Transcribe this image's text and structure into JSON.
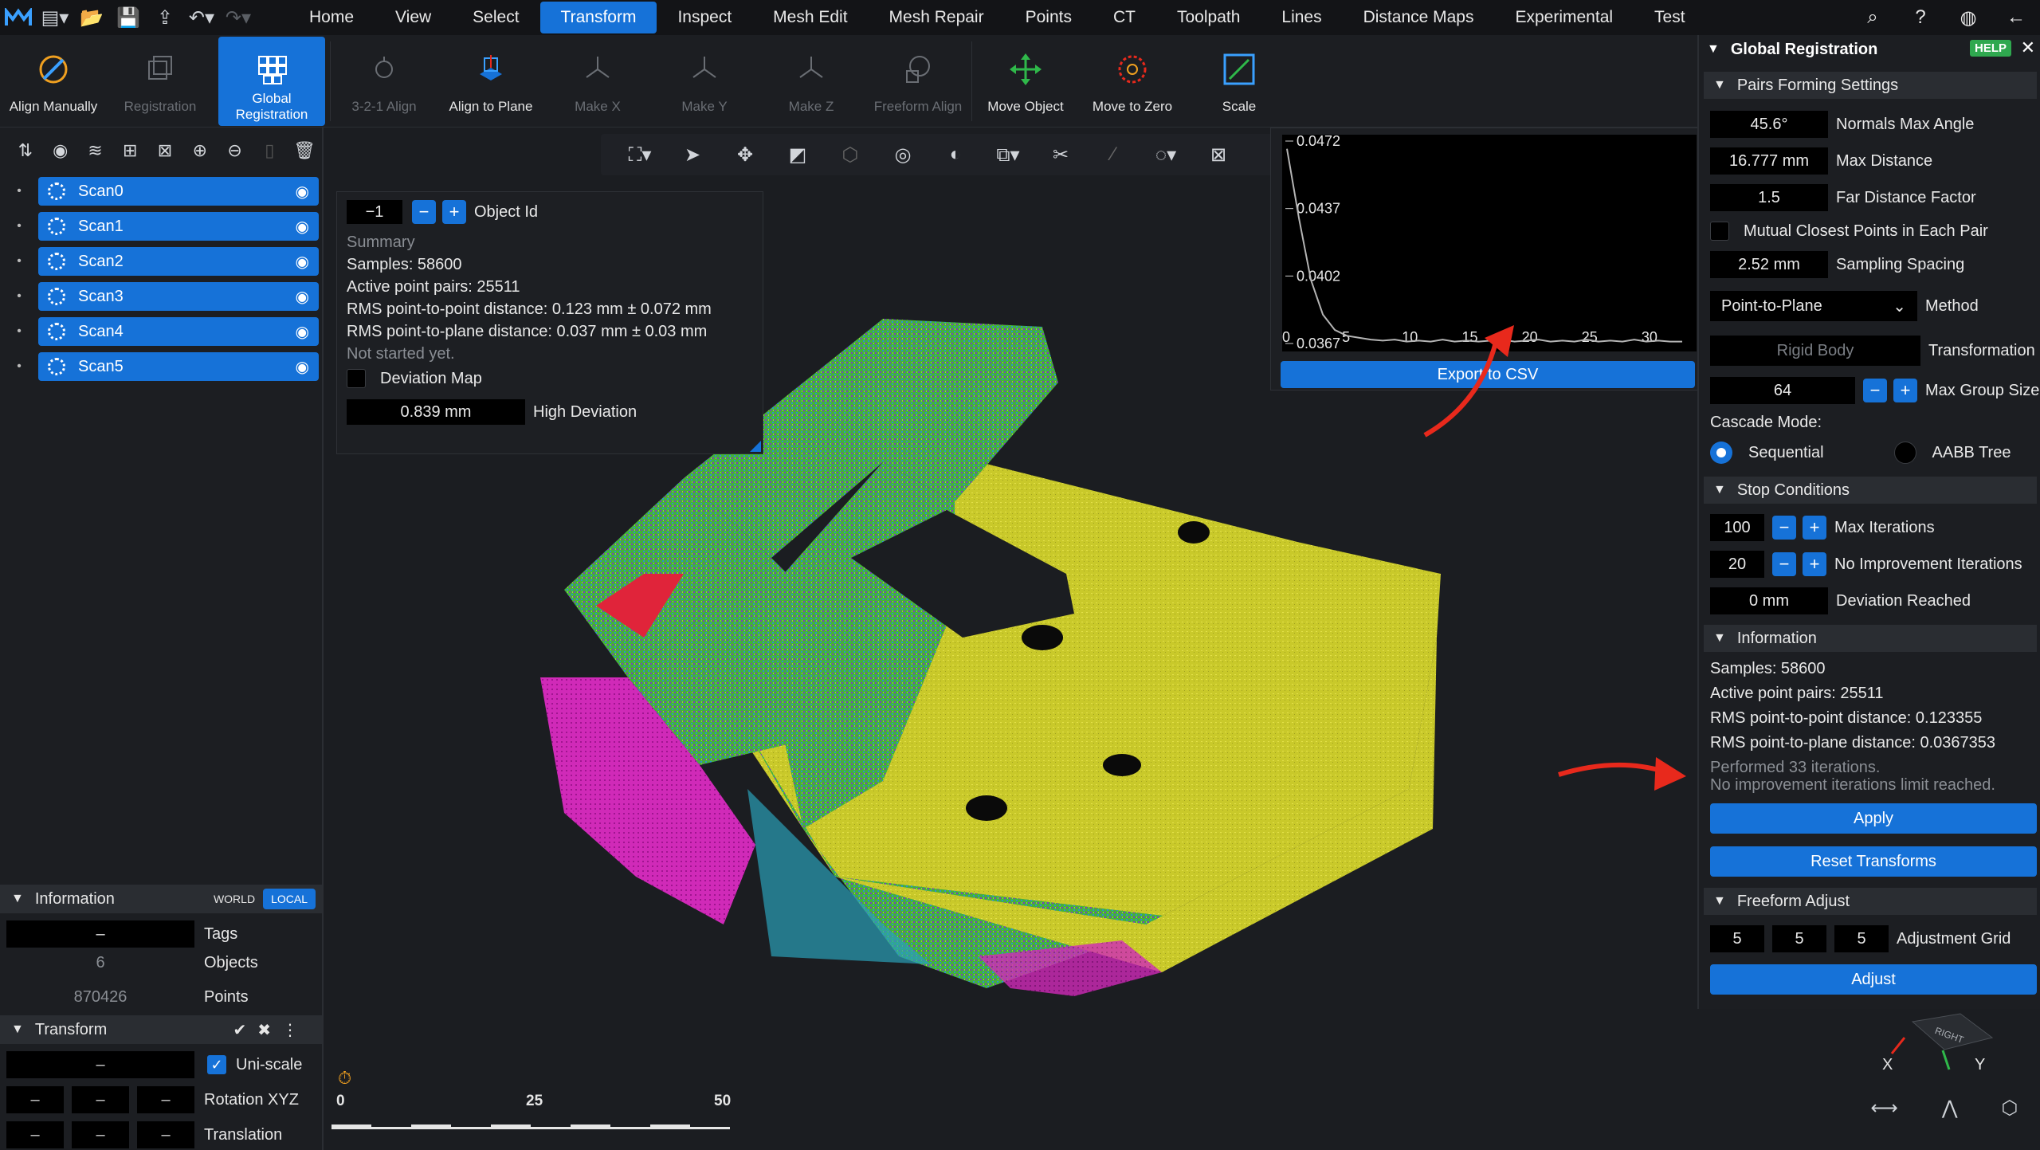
{
  "menubar": {
    "items": [
      "Home",
      "View",
      "Select",
      "Transform",
      "Inspect",
      "Mesh Edit",
      "Mesh Repair",
      "Points",
      "CT",
      "Toolpath",
      "Lines",
      "Distance Maps",
      "Experimental",
      "Test"
    ],
    "active": "Transform"
  },
  "ribbon": {
    "buttons": [
      {
        "label": "Align Manually",
        "icon": "align-manually-icon",
        "state": "normal"
      },
      {
        "label": "Registration",
        "icon": "registration-icon",
        "state": "disabled"
      },
      {
        "label": "Global\nRegistration",
        "icon": "global-registration-icon",
        "state": "active"
      },
      {
        "label": "3-2-1 Align",
        "icon": "three-two-one-icon",
        "state": "disabled"
      },
      {
        "label": "Align to Plane",
        "icon": "align-plane-icon",
        "state": "normal"
      },
      {
        "label": "Make X",
        "icon": "make-x-icon",
        "state": "disabled"
      },
      {
        "label": "Make Y",
        "icon": "make-y-icon",
        "state": "disabled"
      },
      {
        "label": "Make Z",
        "icon": "make-z-icon",
        "state": "disabled"
      },
      {
        "label": "Freeform Align",
        "icon": "freeform-align-icon",
        "state": "disabled"
      },
      {
        "label": "Move Object",
        "icon": "move-object-icon",
        "state": "normal"
      },
      {
        "label": "Move to Zero",
        "icon": "move-to-zero-icon",
        "state": "normal"
      },
      {
        "label": "Scale",
        "icon": "scale-icon",
        "state": "normal"
      }
    ]
  },
  "scene": {
    "scans": [
      "Scan0",
      "Scan1",
      "Scan2",
      "Scan3",
      "Scan4",
      "Scan5"
    ]
  },
  "information": {
    "title": "Information",
    "world": "WORLD",
    "local": "LOCAL",
    "tags_value": "–",
    "tags_label": "Tags",
    "objects_value": "6",
    "objects_label": "Objects",
    "points_value": "870426",
    "points_label": "Points"
  },
  "transform": {
    "title": "Transform",
    "scale_value": "–",
    "uniscale_label": "Uni-scale",
    "rotation_values": [
      "–",
      "–",
      "–"
    ],
    "rotation_label": "Rotation XYZ",
    "translation_values": [
      "–",
      "–",
      "–"
    ],
    "translation_label": "Translation"
  },
  "summary_panel": {
    "object_id_value": "−1",
    "object_id_label": "Object Id",
    "summary_label": "Summary",
    "samples": "Samples: 58600",
    "active_pairs": "Active point pairs: 25511",
    "rms_p2p": "RMS point-to-point distance: 0.123 mm ± 0.072 mm",
    "rms_p2pl": "RMS point-to-plane distance: 0.037 mm ± 0.03 mm",
    "status": "Not started yet.",
    "deviation_map_label": "Deviation Map",
    "high_deviation_value": "0.839 mm",
    "high_deviation_label": "High Deviation"
  },
  "plot_panel": {
    "export_label": "Export to CSV"
  },
  "chart_data": {
    "type": "line",
    "title": "",
    "xlabel": "",
    "ylabel": "",
    "x_ticks": [
      0,
      5,
      10,
      15,
      20,
      25,
      30
    ],
    "y_ticks": [
      0.0472,
      0.0437,
      0.0402,
      0.0367
    ],
    "xlim": [
      0,
      33
    ],
    "ylim": [
      0.0367,
      0.0472
    ],
    "series": [
      {
        "x": [
          0,
          1,
          2,
          3,
          4,
          5,
          6,
          7,
          8,
          9,
          10,
          11,
          12,
          13,
          14,
          15,
          16,
          17,
          18,
          19,
          20,
          21,
          22,
          23,
          24,
          25,
          26,
          27,
          28,
          29,
          30,
          31,
          32,
          33
        ],
        "values": [
          0.0468,
          0.0432,
          0.04,
          0.0382,
          0.0374,
          0.0371,
          0.037,
          0.0369,
          0.03685,
          0.0369,
          0.0368,
          0.03685,
          0.0368,
          0.0369,
          0.0368,
          0.03685,
          0.0368,
          0.03685,
          0.0369,
          0.0368,
          0.03685,
          0.0369,
          0.0368,
          0.03685,
          0.0368,
          0.0369,
          0.0368,
          0.03685,
          0.0368,
          0.0369,
          0.0368,
          0.03685,
          0.0368,
          0.0368
        ]
      }
    ],
    "color": "#b4b4b4"
  },
  "scalebar": {
    "labels": [
      "0",
      "25",
      "50"
    ]
  },
  "global_registration": {
    "title": "Global Registration",
    "help": "HELP",
    "pairs_section": "Pairs Forming Settings",
    "normals_max_angle_value": "45.6°",
    "normals_max_angle_label": "Normals Max Angle",
    "max_distance_value": "16.777 mm",
    "max_distance_label": "Max Distance",
    "far_distance_value": "1.5",
    "far_distance_label": "Far Distance Factor",
    "mutual_label": "Mutual Closest Points in Each Pair",
    "sampling_value": "2.52 mm",
    "sampling_label": "Sampling Spacing",
    "method_value": "Point-to-Plane",
    "method_label": "Method",
    "transformation_value": "Rigid Body",
    "transformation_label": "Transformation",
    "max_group_value": "64",
    "max_group_label": "Max Group Size",
    "cascade_label": "Cascade Mode:",
    "cascade_sequential": "Sequential",
    "cascade_aabb": "AABB Tree",
    "stop_section": "Stop Conditions",
    "max_iter_value": "100",
    "max_iter_label": "Max Iterations",
    "no_improve_value": "20",
    "no_improve_label": "No Improvement Iterations",
    "deviation_value": "0 mm",
    "deviation_label": "Deviation Reached",
    "info_section": "Information",
    "info_samples": "Samples: 58600",
    "info_pairs": "Active point pairs: 25511",
    "info_rms_p2p": "RMS point-to-point distance: 0.123355",
    "info_rms_p2pl": "RMS point-to-plane distance: 0.0367353",
    "info_performed": "Performed 33 iterations.",
    "info_limit": "No improvement iterations limit reached.",
    "apply_label": "Apply",
    "reset_label": "Reset Transforms",
    "freeform_section": "Freeform Adjust",
    "grid_values": [
      "5",
      "5",
      "5"
    ],
    "grid_label": "Adjustment Grid",
    "adjust_label": "Adjust"
  },
  "gizmo": {
    "x": "X",
    "y": "Y",
    "face": "RIGHT"
  }
}
